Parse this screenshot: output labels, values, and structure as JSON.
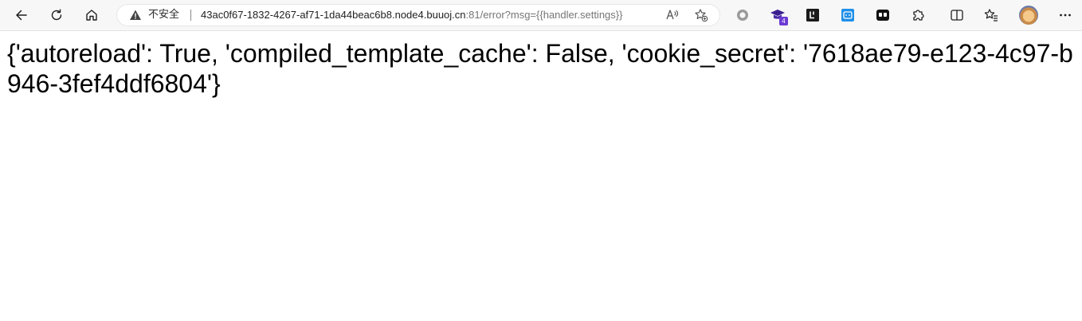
{
  "browser": {
    "address_bar": {
      "security_label": "不安全",
      "url_host": "43ac0f67-1832-4267-af71-1da44beac6b8.node4.buuoj.cn",
      "url_rest": ":81/error?msg={{handler.settings}}"
    },
    "extensions": {
      "badge_count": "4"
    },
    "icons": {
      "back": "arrow-left-icon",
      "refresh": "refresh-icon",
      "home": "home-icon",
      "warning": "warning-icon",
      "read_aloud": "read-aloud-icon",
      "add_favorite": "add-favorite-icon",
      "extension_1": "circle-extension-icon",
      "extension_2": "hat-extension-icon",
      "extension_3": "leetcode-extension-icon",
      "extension_4": "bilibili-extension-icon",
      "extension_5": "app-extension-icon",
      "extensions": "puzzle-icon",
      "split_screen": "split-screen-icon",
      "favorites": "favorites-icon",
      "profile": "avatar",
      "more": "more-icon"
    }
  },
  "page": {
    "body_text": "{'autoreload': True, 'compiled_template_cache': False, 'cookie_secret': '7618ae79-e123-4c97-b946-3fef4ddf6804'}"
  }
}
